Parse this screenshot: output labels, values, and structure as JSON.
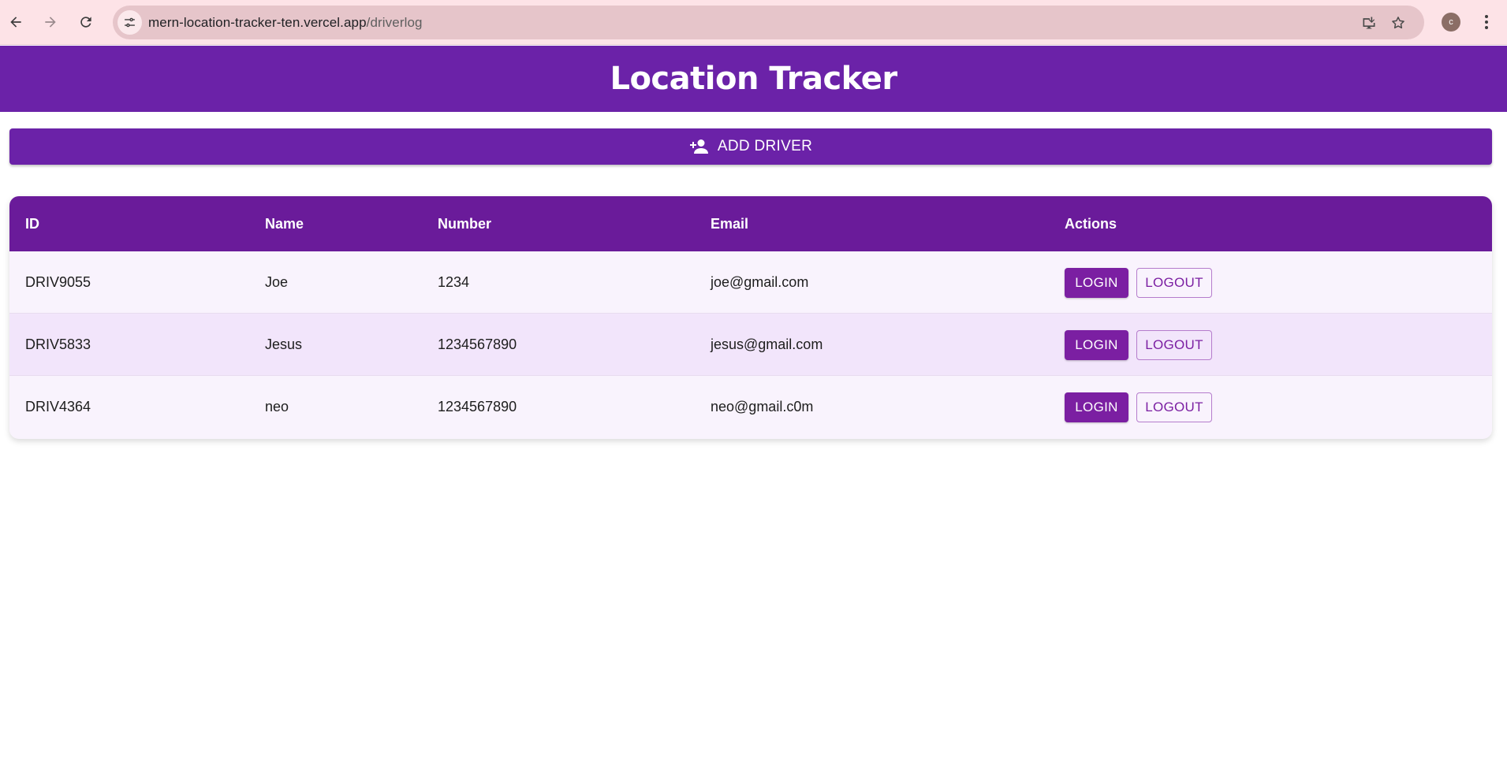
{
  "browser": {
    "url_host": "mern-location-tracker-ten.vercel.app",
    "url_path": "/driverlog",
    "profile_initial": "c"
  },
  "header": {
    "title": "Location Tracker"
  },
  "add_driver": {
    "label": "ADD DRIVER",
    "icon": "person-add-icon"
  },
  "table": {
    "columns": [
      "ID",
      "Name",
      "Number",
      "Email",
      "Actions"
    ],
    "rows": [
      {
        "id": "DRIV9055",
        "name": "Joe",
        "number": "1234",
        "email": "joe@gmail.com",
        "login": "LOGIN",
        "logout": "LOGOUT"
      },
      {
        "id": "DRIV5833",
        "name": "Jesus",
        "number": "1234567890",
        "email": "jesus@gmail.com",
        "login": "LOGIN",
        "logout": "LOGOUT"
      },
      {
        "id": "DRIV4364",
        "name": "neo",
        "number": "1234567890",
        "email": "neo@gmail.c0m",
        "login": "LOGIN",
        "logout": "LOGOUT"
      }
    ]
  },
  "colors": {
    "primary": "#6b22a8",
    "table_header": "#6a1b9a",
    "button": "#7b1fa2",
    "row_odd": "#f9f3fd",
    "row_even": "#f2e5fb",
    "chrome_bg": "#fde3e7"
  }
}
